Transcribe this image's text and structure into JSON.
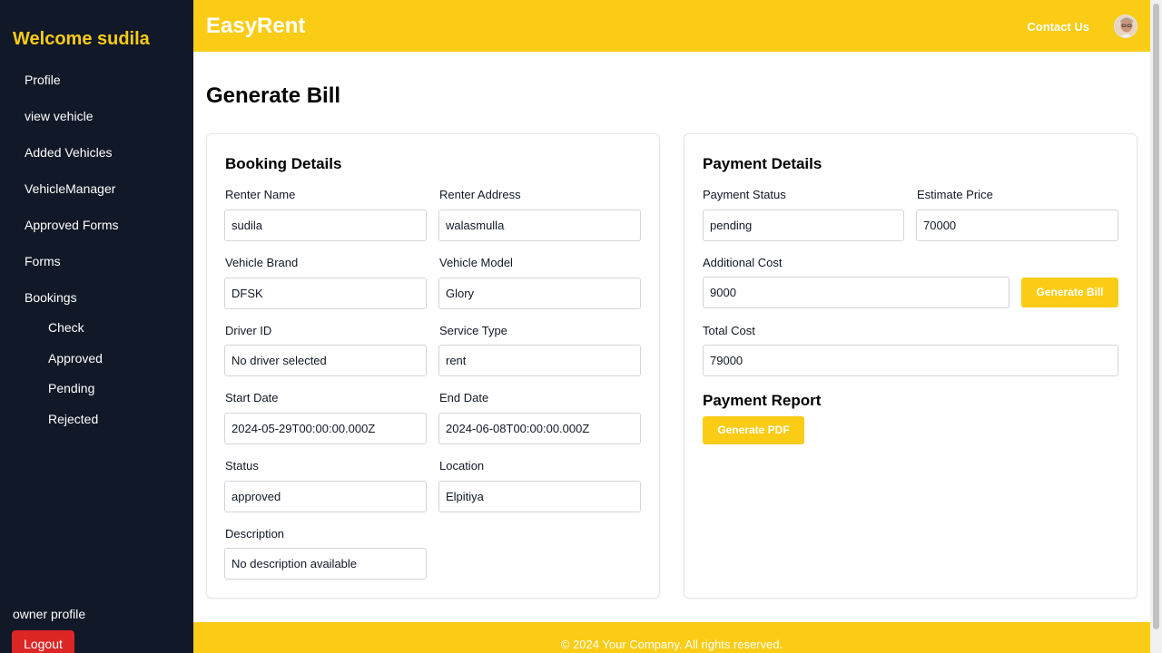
{
  "sidebar": {
    "welcome": "Welcome sudila",
    "items": [
      "Profile",
      "view vehicle",
      "Added Vehicles",
      "VehicleManager",
      "Approved Forms",
      "Forms",
      "Bookings"
    ],
    "sub_items": [
      "Check",
      "Approved",
      "Pending",
      "Rejected"
    ],
    "owner_profile": "owner profile",
    "logout": "Logout"
  },
  "header": {
    "brand": "EasyRent",
    "contact": "Contact Us"
  },
  "main": {
    "title": "Generate Bill"
  },
  "booking": {
    "title": "Booking Details",
    "renter_name": {
      "label": "Renter Name",
      "value": "sudila"
    },
    "renter_address": {
      "label": "Renter Address",
      "value": "walasmulla"
    },
    "vehicle_brand": {
      "label": "Vehicle Brand",
      "value": "DFSK"
    },
    "vehicle_model": {
      "label": "Vehicle Model",
      "value": "Glory"
    },
    "driver_id": {
      "label": "Driver ID",
      "value": "No driver selected"
    },
    "service_type": {
      "label": "Service Type",
      "value": "rent"
    },
    "start_date": {
      "label": "Start Date",
      "value": "2024-05-29T00:00:00.000Z"
    },
    "end_date": {
      "label": "End Date",
      "value": "2024-06-08T00:00:00.000Z"
    },
    "status": {
      "label": "Status",
      "value": "approved"
    },
    "location": {
      "label": "Location",
      "value": "Elpitiya"
    },
    "description": {
      "label": "Description",
      "value": "No description available"
    }
  },
  "payment": {
    "title": "Payment Details",
    "payment_status": {
      "label": "Payment Status",
      "value": "pending"
    },
    "estimate_price": {
      "label": "Estimate Price",
      "value": "70000"
    },
    "additional_cost": {
      "label": "Additional Cost",
      "value": "9000"
    },
    "generate_bill_button": "Generate Bill",
    "total_cost": {
      "label": "Total Cost",
      "value": "79000"
    },
    "report_title": "Payment Report",
    "generate_pdf_button": "Generate PDF"
  },
  "footer": {
    "text": "© 2024 Your Company. All rights reserved."
  },
  "colors": {
    "sidebar_bg": "#111827",
    "accent": "#facc15",
    "logout": "#dc2626"
  },
  "icons": {
    "avatar": "user-avatar"
  }
}
